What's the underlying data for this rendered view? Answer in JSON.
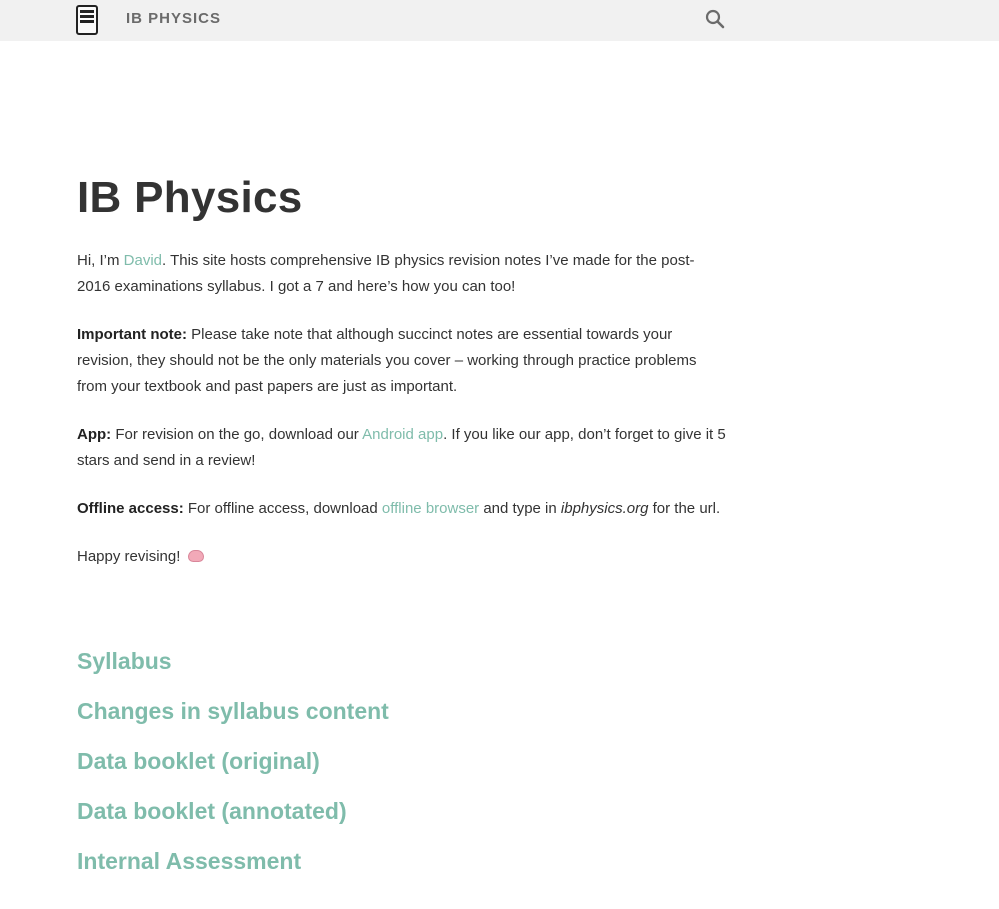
{
  "header": {
    "site_title": "IB PHYSICS",
    "menu_icon": "hamburger-menu-icon",
    "search_icon": "search-icon"
  },
  "main": {
    "title": "IB Physics",
    "intro": {
      "prefix": "Hi, I’m ",
      "author_link": "David",
      "suffix": ". This site hosts comprehensive IB physics revision notes I’ve made for the post-2016 examinations syllabus. I got a 7 and here’s how you can too!"
    },
    "important": {
      "label": "Important note:",
      "text": " Please take note that although succinct notes are essential towards your revision, they should not be the only materials you cover – working through practice problems from your textbook and past papers are just as important."
    },
    "app": {
      "label": "App:",
      "prefix": " For revision on the go, download our ",
      "link": "Android app",
      "suffix": ". If you like our app, don’t forget to give it 5 stars and send in a review!"
    },
    "offline": {
      "label": "Offline access:",
      "prefix": " For offline access, download ",
      "link": "offline browser",
      "middle": " and type in ",
      "url": "ibphysics.org",
      "suffix": " for the url."
    },
    "closing": {
      "text": "Happy revising! ",
      "emoji_icon": "brain-emoji-icon"
    },
    "sections": [
      "Syllabus",
      "Changes in syllabus content",
      "Data booklet (original)",
      "Data booklet (annotated)",
      "Internal Assessment"
    ]
  },
  "colors": {
    "accent": "#7fbcab",
    "topbar_bg": "#f1f1f1",
    "text": "#333333"
  }
}
